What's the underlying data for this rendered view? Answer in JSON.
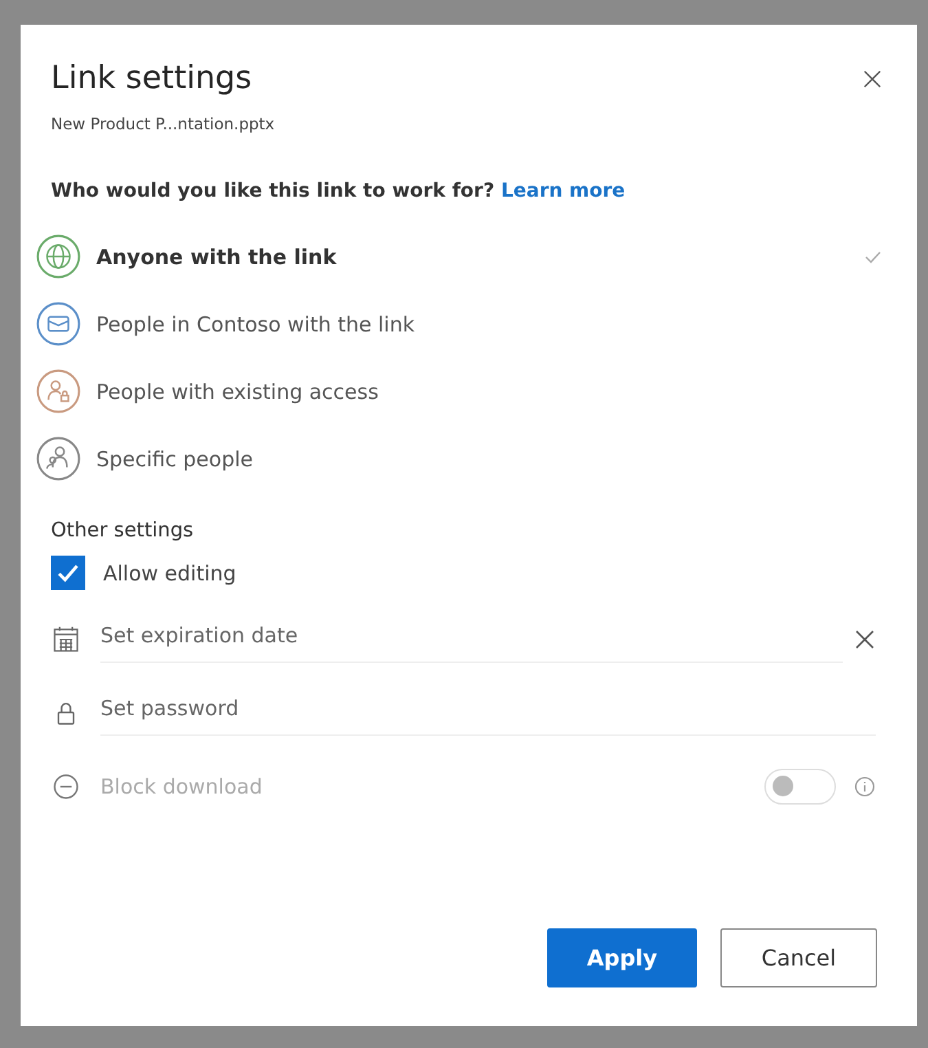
{
  "dialog": {
    "title": "Link settings",
    "file_name": "New Product P...ntation.pptx"
  },
  "question": {
    "text": "Who would you like this link to work for?",
    "link": "Learn more"
  },
  "options": [
    {
      "kind": "globe",
      "label": "Anyone with the link",
      "color": "#6aab6a",
      "selected": true
    },
    {
      "kind": "org",
      "label": "People in Contoso with the link",
      "color": "#5b8fc9",
      "selected": false
    },
    {
      "kind": "existing",
      "label": "People with existing access",
      "color": "#c99a80",
      "selected": false
    },
    {
      "kind": "specific",
      "label": "Specific people",
      "color": "#888888",
      "selected": false
    }
  ],
  "other_settings": {
    "heading": "Other settings",
    "allow_editing": {
      "label": "Allow editing",
      "checked": true
    },
    "fields": [
      {
        "kind": "date",
        "placeholder": "Set expiration date",
        "clearable": true
      },
      {
        "kind": "password",
        "placeholder": "Set password",
        "clearable": false
      }
    ],
    "block_download": {
      "label": "Block download",
      "on": false,
      "disabled": true
    }
  },
  "buttons": [
    {
      "label": "Apply",
      "primary": true
    },
    {
      "label": "Cancel",
      "primary": false
    }
  ]
}
